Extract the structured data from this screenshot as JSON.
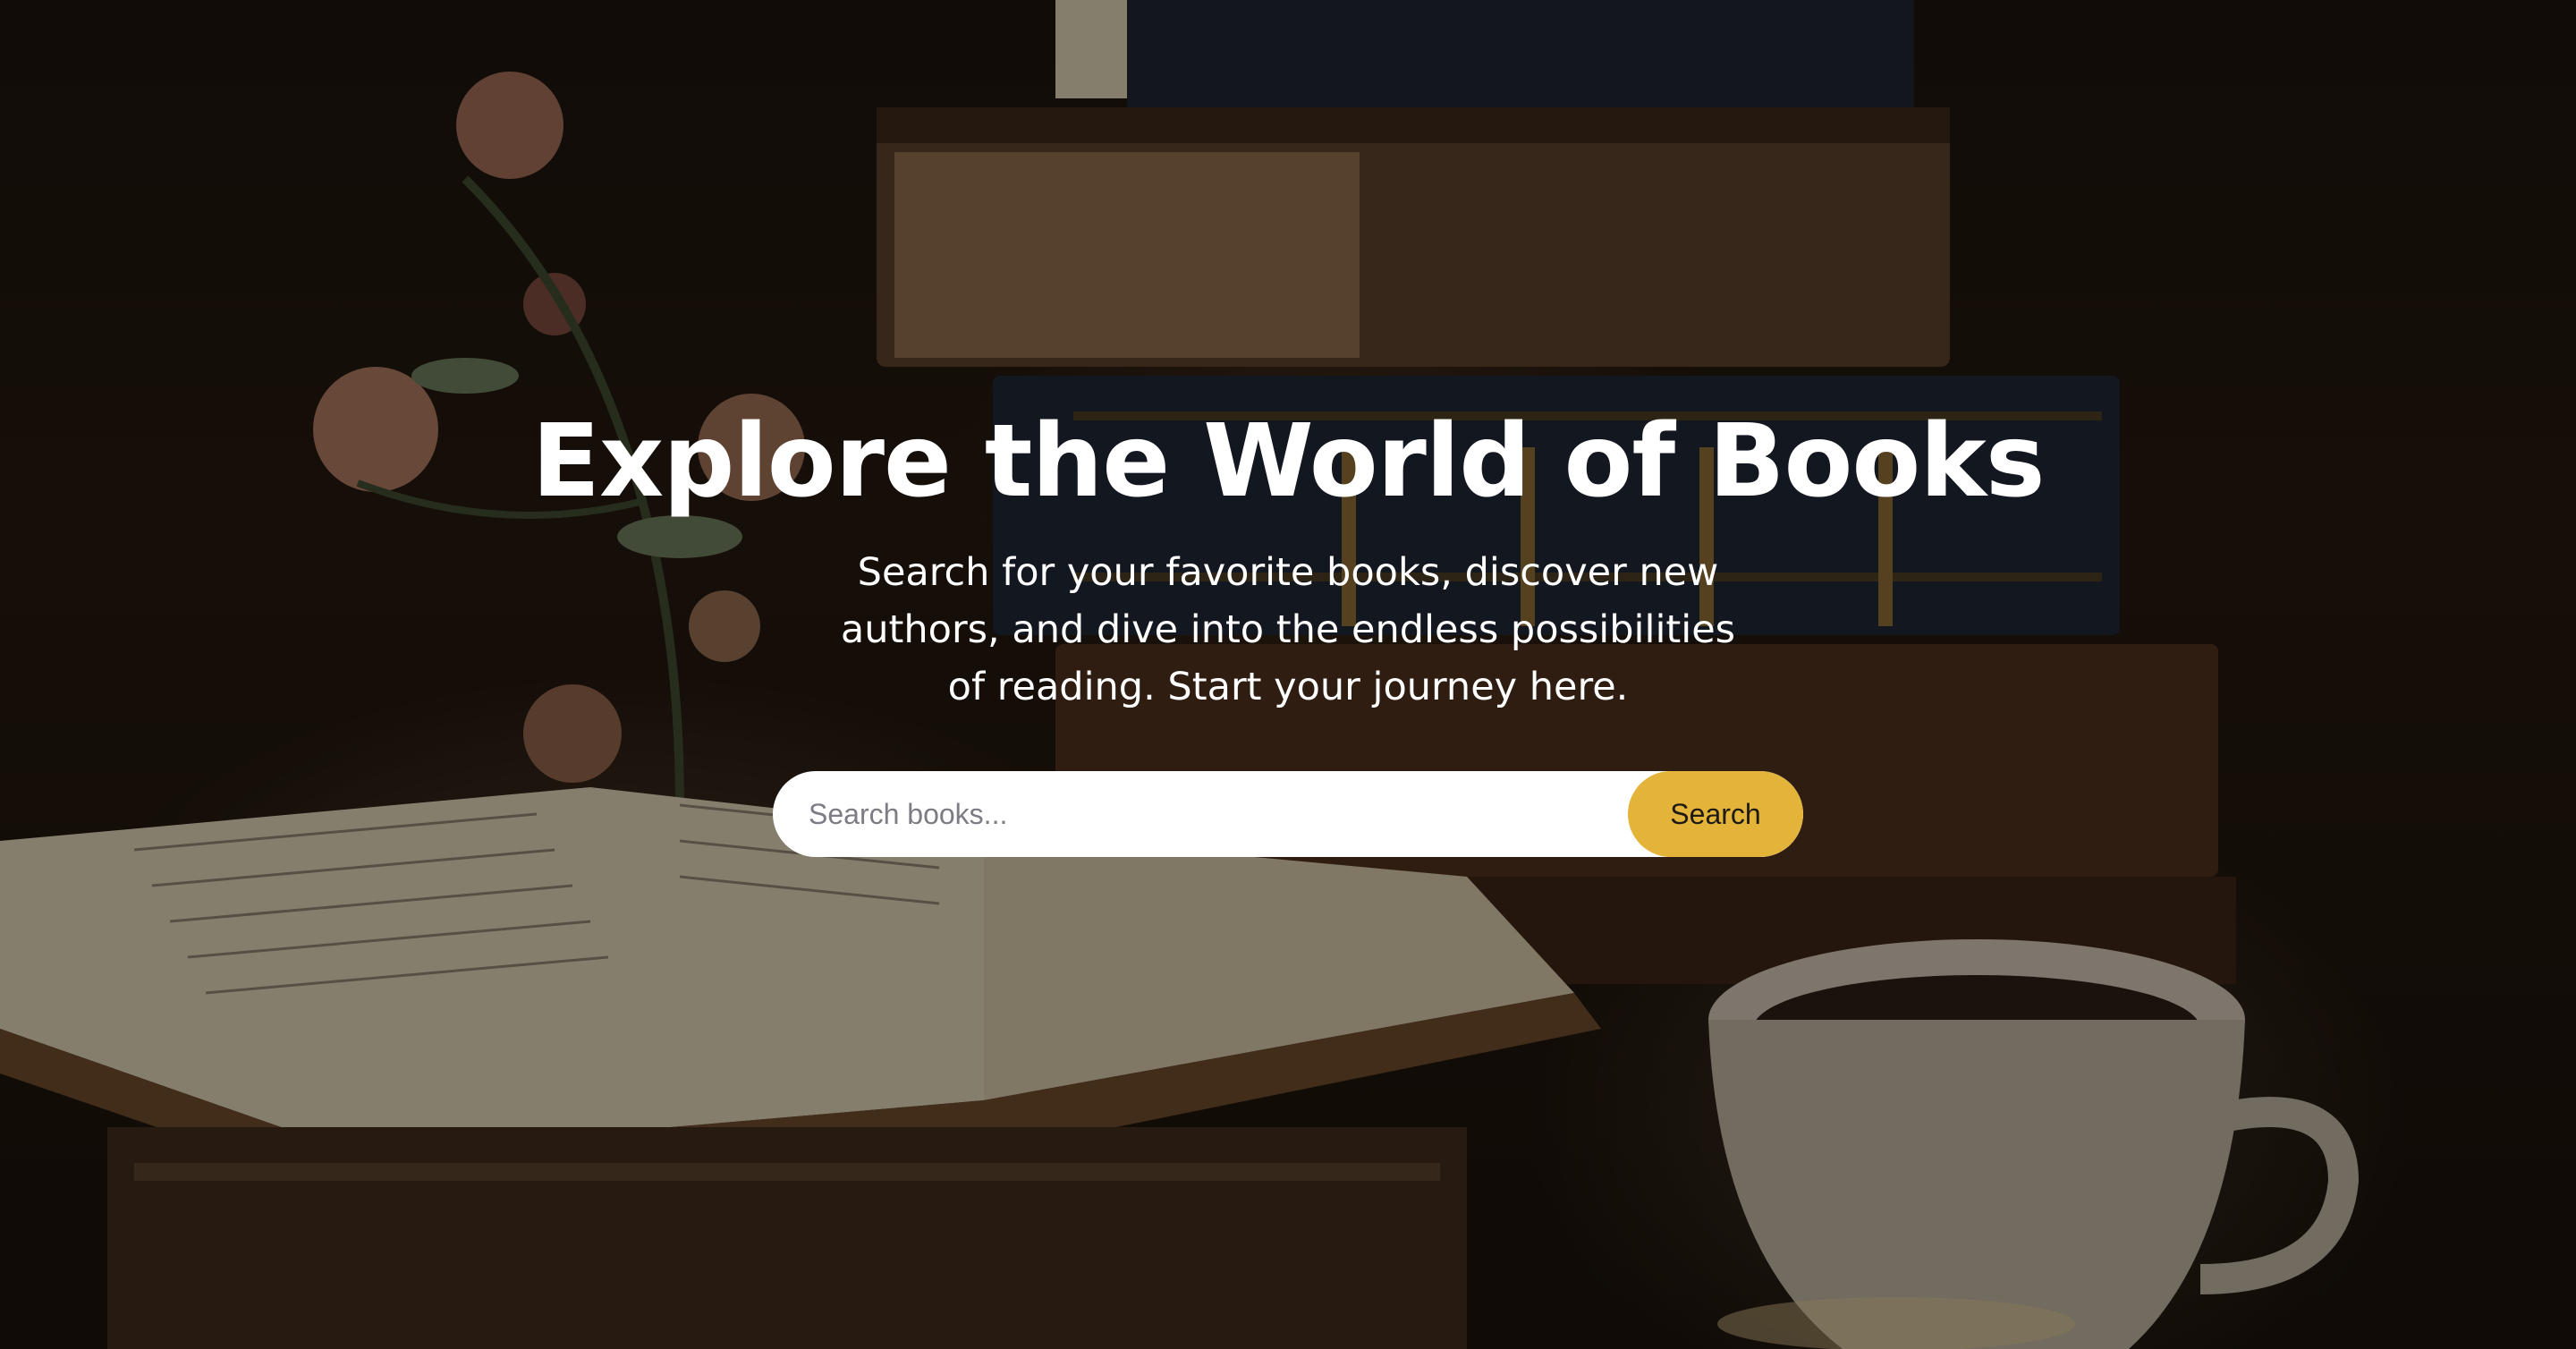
{
  "hero": {
    "title": "Explore the World of Books",
    "subtitle": "Search for your favorite books, discover new authors, and dive into the endless possibilities of reading. Start your journey here.",
    "background_image": "books-and-coffee-photo"
  },
  "search": {
    "placeholder": "Search books...",
    "value": "",
    "button_label": "Search"
  },
  "colors": {
    "accent": "#e3b33a",
    "title_text": "#ffffff",
    "input_background": "#ffffff"
  }
}
